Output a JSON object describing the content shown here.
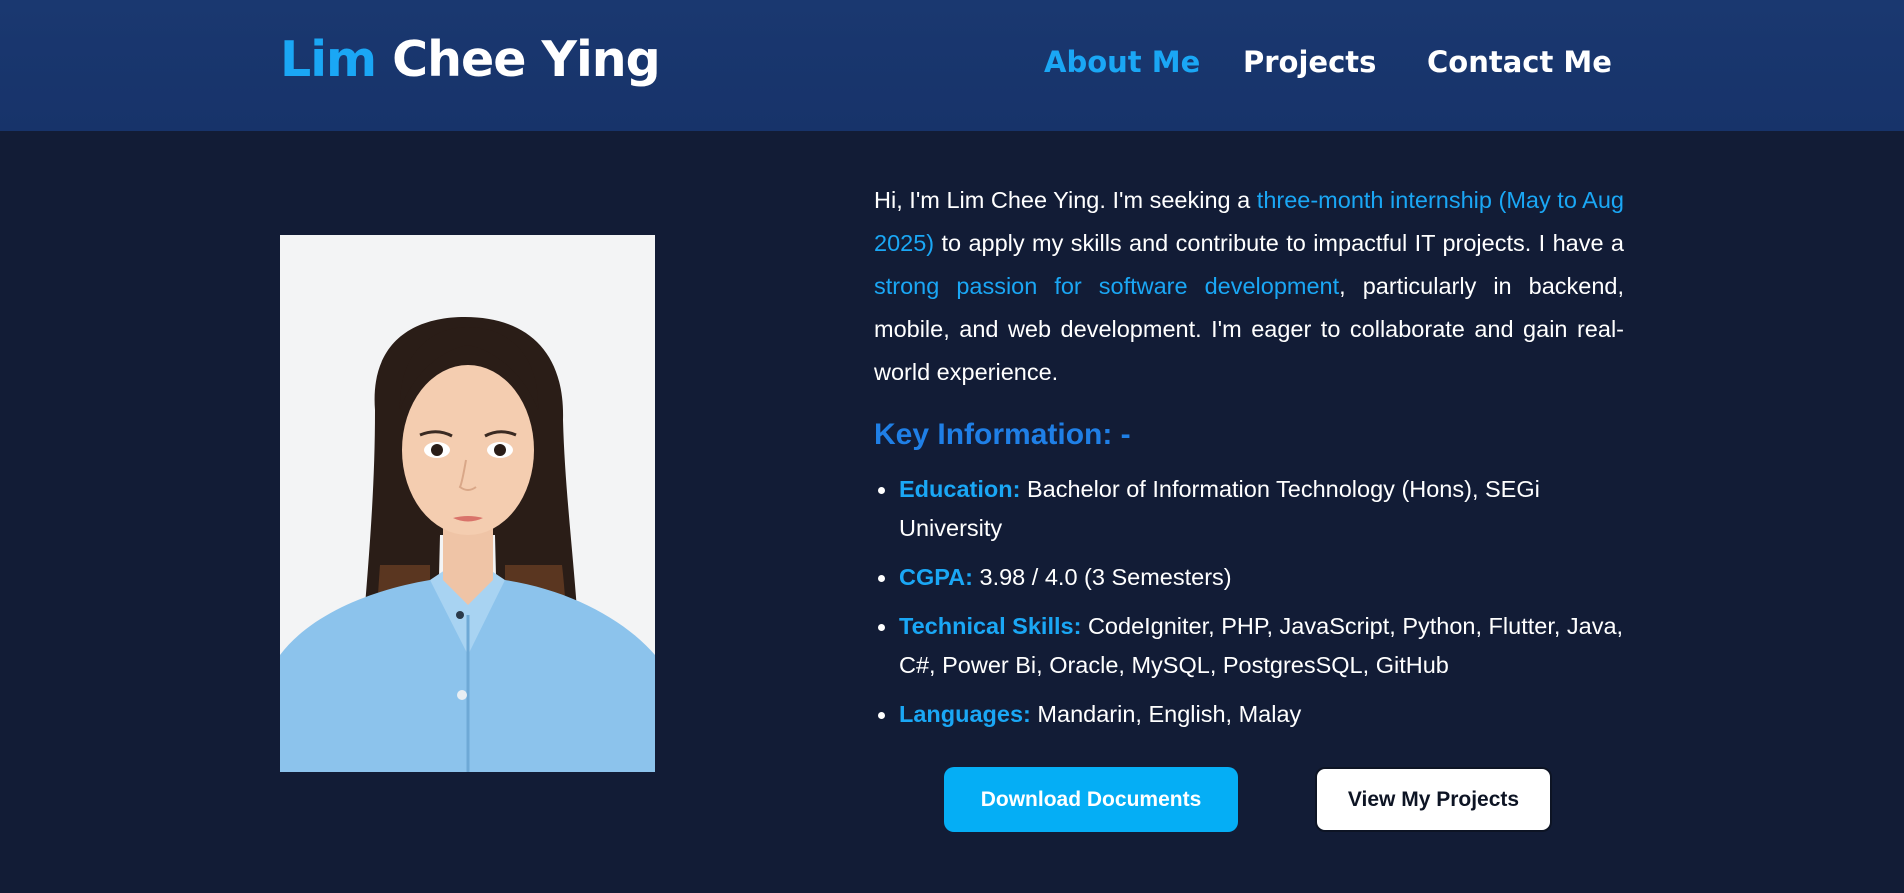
{
  "header": {
    "brand_first": "Lim",
    "brand_rest": "Chee Ying",
    "nav": [
      {
        "label": "About Me",
        "active": true
      },
      {
        "label": "Projects",
        "active": false
      },
      {
        "label": "Contact Me",
        "active": false
      }
    ]
  },
  "intro": {
    "p1": "Hi, I'm Lim Chee Ying. I'm seeking a ",
    "h1": "three-month internship (May to Aug 2025)",
    "p2": " to apply my skills and contribute to impactful IT projects. I have a ",
    "h2": "strong passion for software development",
    "p3": ", particularly in backend, mobile, and web development. I'm eager to collaborate and gain real-world experience."
  },
  "key_info": {
    "title": "Key Information: -",
    "items": [
      {
        "label": "Education:",
        "value": "Bachelor of Information Technology (Hons), SEGi University"
      },
      {
        "label": "CGPA:",
        "value": "3.98 / 4.0 (3 Semesters)"
      },
      {
        "label": "Technical Skills:",
        "value": "CodeIgniter, PHP, JavaScript, Python, Flutter, Java, C#, Power Bi, Oracle, MySQL, PostgresSQL, GitHub"
      },
      {
        "label": "Languages:",
        "value": "Mandarin, English, Malay"
      }
    ]
  },
  "buttons": {
    "download": "Download Documents",
    "projects": "View My Projects"
  },
  "colors": {
    "accent": "#1aa7f5",
    "background": "#121c36",
    "navbar": "#17336a",
    "key_title": "#1f7fe6"
  }
}
